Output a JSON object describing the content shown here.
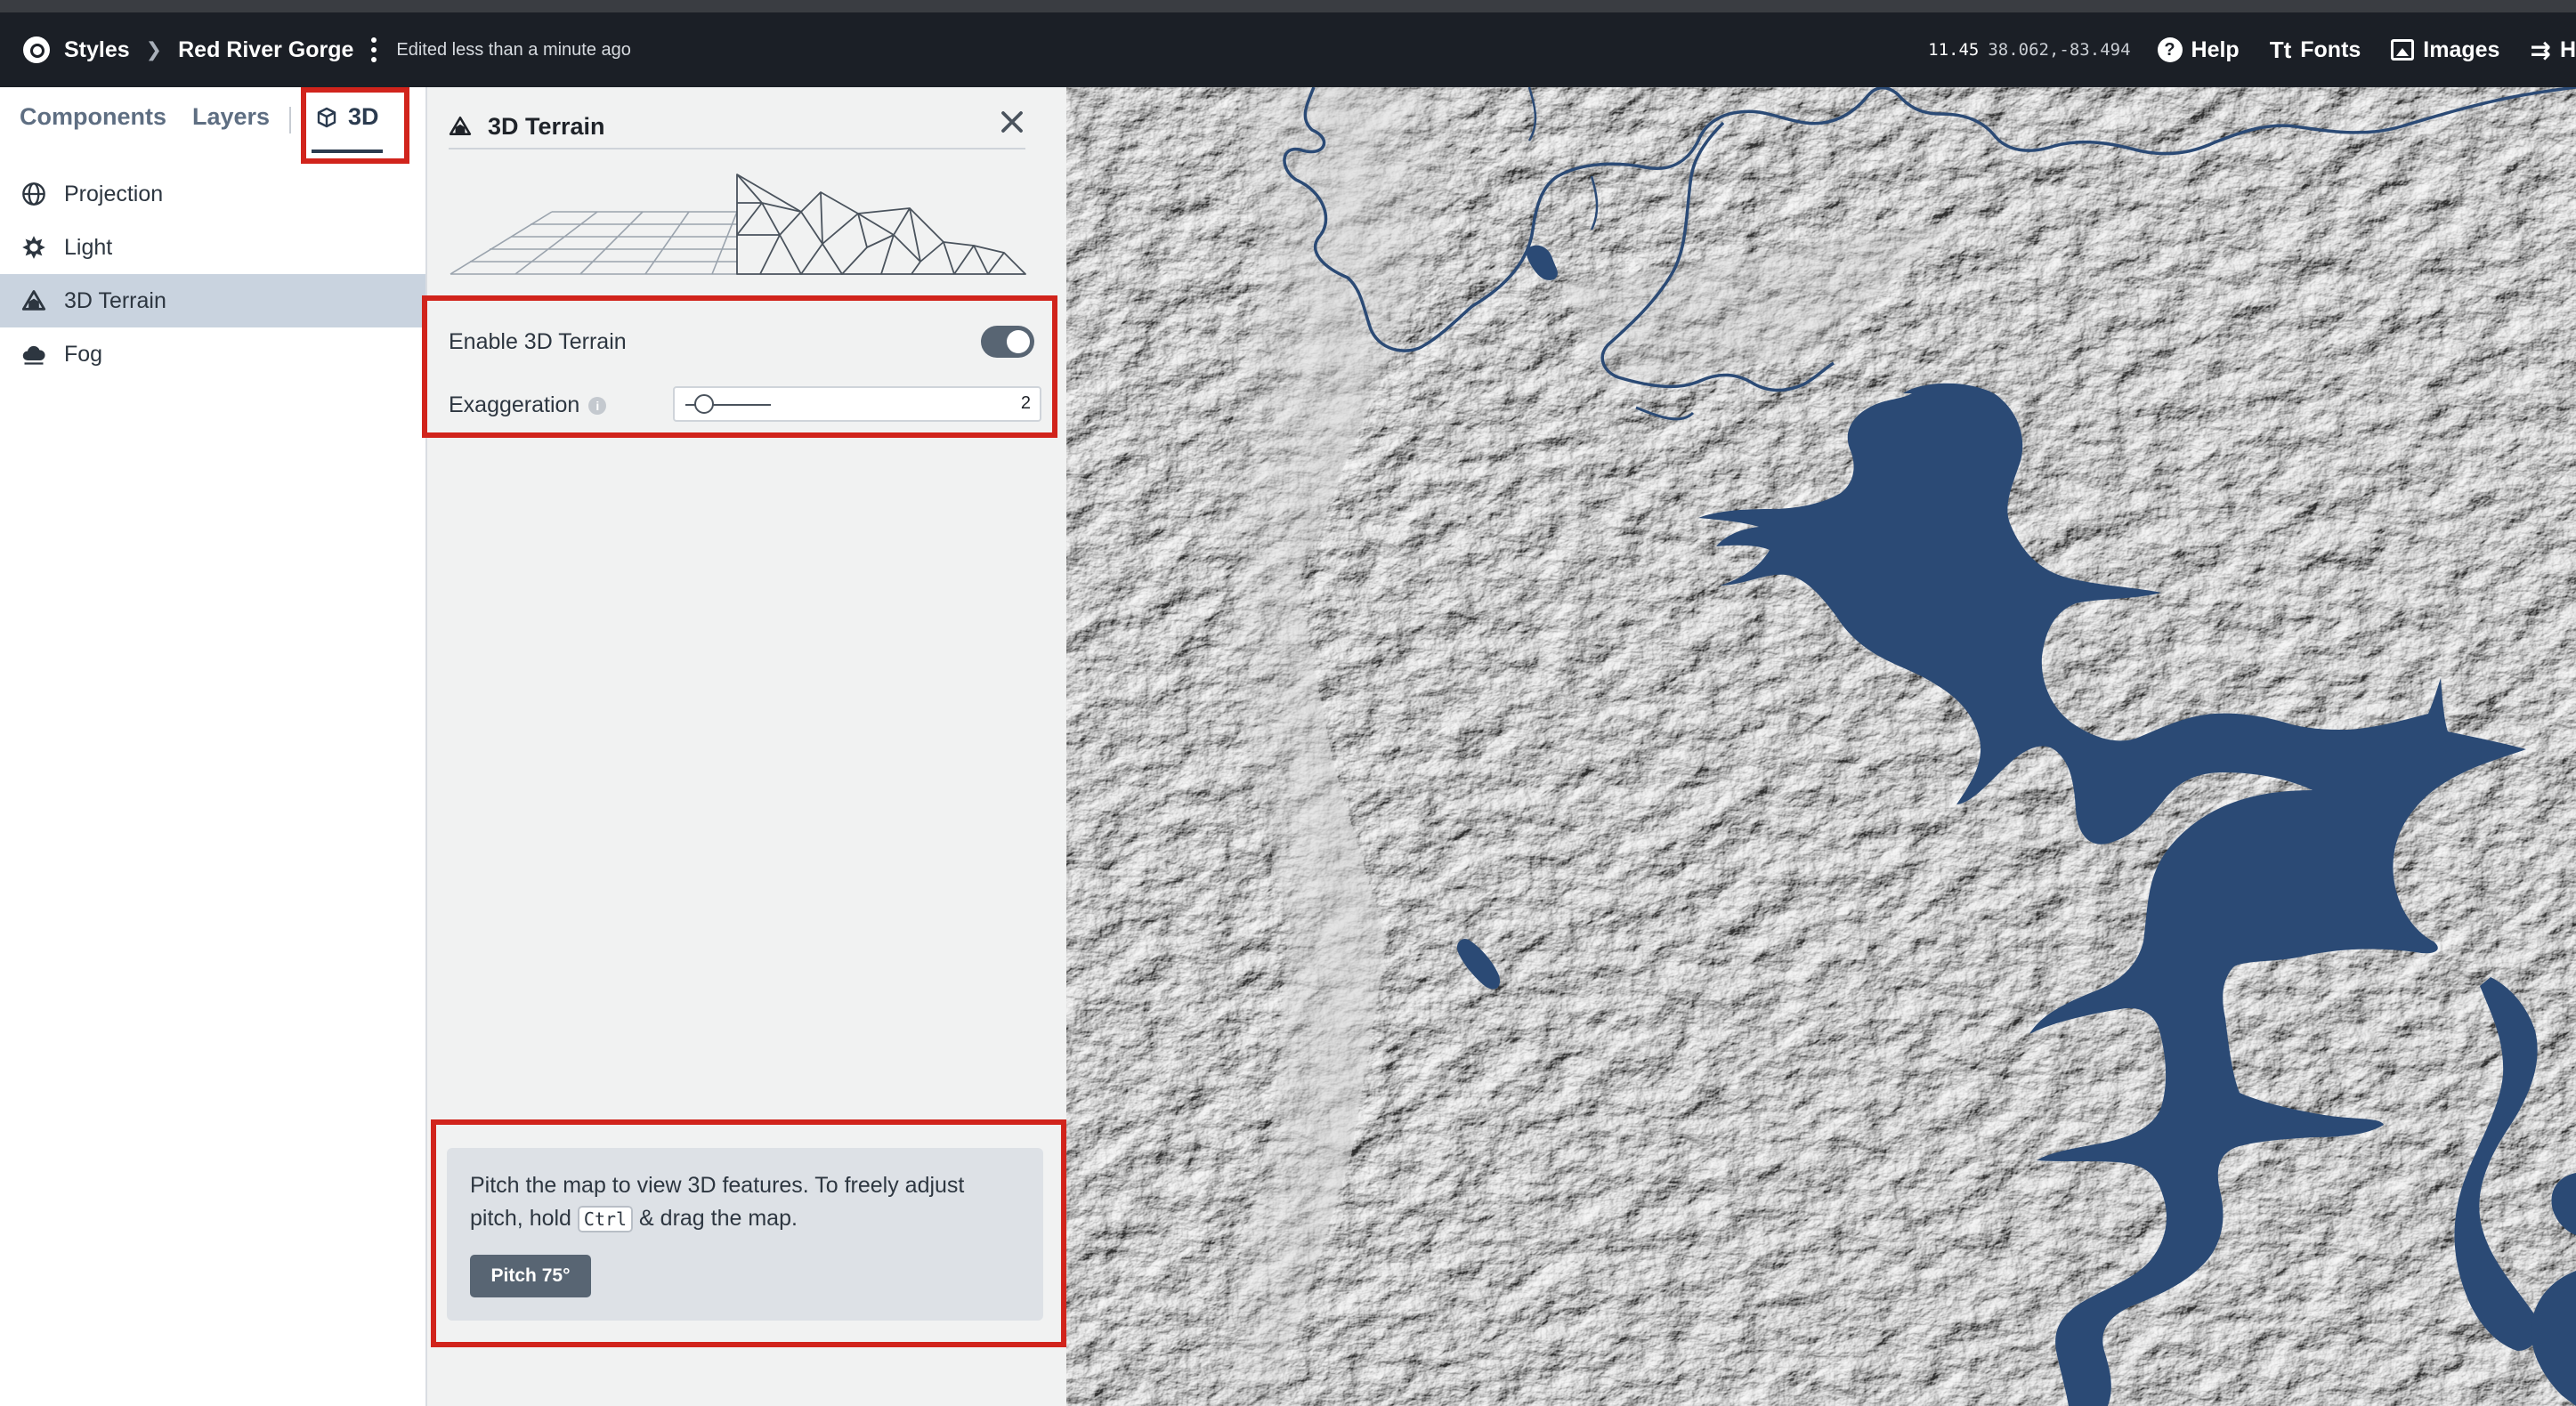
{
  "topbar": {
    "breadcrumb_root": "Styles",
    "breadcrumb_current": "Red River Gorge",
    "edited_status": "Edited less than a minute ago",
    "zoom": "11.45",
    "coordinates": "38.062,-83.494",
    "help_label": "Help",
    "fonts_label": "Fonts",
    "images_label": "Images",
    "history_label": "H"
  },
  "sidebar": {
    "tabs": {
      "components": "Components",
      "layers": "Layers",
      "three_d": "3D"
    },
    "items": [
      {
        "label": "Projection",
        "icon": "globe-icon"
      },
      {
        "label": "Light",
        "icon": "light-icon"
      },
      {
        "label": "3D Terrain",
        "icon": "mountain-icon",
        "active": true
      },
      {
        "label": "Fog",
        "icon": "fog-icon"
      }
    ]
  },
  "panel": {
    "title": "3D Terrain",
    "enable_label": "Enable 3D Terrain",
    "enable_value": true,
    "exaggeration_label": "Exaggeration",
    "exaggeration_value": "2",
    "tip_text_1": "Pitch the map to view 3D features. To freely adjust pitch, hold ",
    "tip_key": "Ctrl",
    "tip_text_2": " & drag the map.",
    "pitch_button": "Pitch 75°"
  },
  "colors": {
    "topbar_bg": "#1b1f26",
    "highlight": "#d1241c",
    "water": "#2b4a75",
    "active_item": "#c9d3df",
    "toggle_on": "#586573"
  }
}
